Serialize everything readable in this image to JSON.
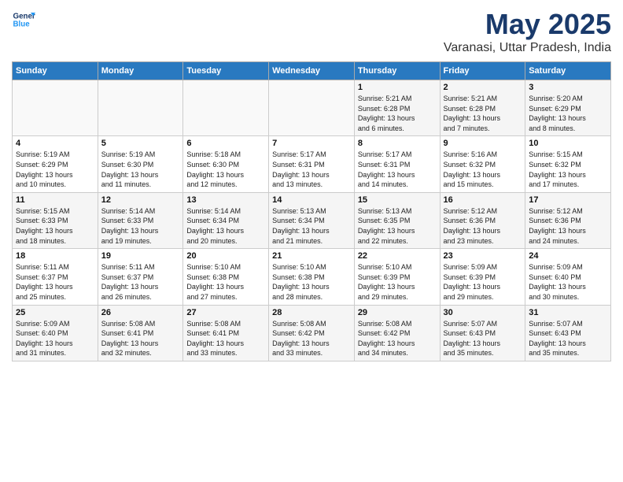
{
  "header": {
    "logo_line1": "General",
    "logo_line2": "Blue",
    "month": "May 2025",
    "location": "Varanasi, Uttar Pradesh, India"
  },
  "days_of_week": [
    "Sunday",
    "Monday",
    "Tuesday",
    "Wednesday",
    "Thursday",
    "Friday",
    "Saturday"
  ],
  "weeks": [
    [
      {
        "day": "",
        "info": ""
      },
      {
        "day": "",
        "info": ""
      },
      {
        "day": "",
        "info": ""
      },
      {
        "day": "",
        "info": ""
      },
      {
        "day": "1",
        "info": "Sunrise: 5:21 AM\nSunset: 6:28 PM\nDaylight: 13 hours\nand 6 minutes."
      },
      {
        "day": "2",
        "info": "Sunrise: 5:21 AM\nSunset: 6:28 PM\nDaylight: 13 hours\nand 7 minutes."
      },
      {
        "day": "3",
        "info": "Sunrise: 5:20 AM\nSunset: 6:29 PM\nDaylight: 13 hours\nand 8 minutes."
      }
    ],
    [
      {
        "day": "4",
        "info": "Sunrise: 5:19 AM\nSunset: 6:29 PM\nDaylight: 13 hours\nand 10 minutes."
      },
      {
        "day": "5",
        "info": "Sunrise: 5:19 AM\nSunset: 6:30 PM\nDaylight: 13 hours\nand 11 minutes."
      },
      {
        "day": "6",
        "info": "Sunrise: 5:18 AM\nSunset: 6:30 PM\nDaylight: 13 hours\nand 12 minutes."
      },
      {
        "day": "7",
        "info": "Sunrise: 5:17 AM\nSunset: 6:31 PM\nDaylight: 13 hours\nand 13 minutes."
      },
      {
        "day": "8",
        "info": "Sunrise: 5:17 AM\nSunset: 6:31 PM\nDaylight: 13 hours\nand 14 minutes."
      },
      {
        "day": "9",
        "info": "Sunrise: 5:16 AM\nSunset: 6:32 PM\nDaylight: 13 hours\nand 15 minutes."
      },
      {
        "day": "10",
        "info": "Sunrise: 5:15 AM\nSunset: 6:32 PM\nDaylight: 13 hours\nand 17 minutes."
      }
    ],
    [
      {
        "day": "11",
        "info": "Sunrise: 5:15 AM\nSunset: 6:33 PM\nDaylight: 13 hours\nand 18 minutes."
      },
      {
        "day": "12",
        "info": "Sunrise: 5:14 AM\nSunset: 6:33 PM\nDaylight: 13 hours\nand 19 minutes."
      },
      {
        "day": "13",
        "info": "Sunrise: 5:14 AM\nSunset: 6:34 PM\nDaylight: 13 hours\nand 20 minutes."
      },
      {
        "day": "14",
        "info": "Sunrise: 5:13 AM\nSunset: 6:34 PM\nDaylight: 13 hours\nand 21 minutes."
      },
      {
        "day": "15",
        "info": "Sunrise: 5:13 AM\nSunset: 6:35 PM\nDaylight: 13 hours\nand 22 minutes."
      },
      {
        "day": "16",
        "info": "Sunrise: 5:12 AM\nSunset: 6:36 PM\nDaylight: 13 hours\nand 23 minutes."
      },
      {
        "day": "17",
        "info": "Sunrise: 5:12 AM\nSunset: 6:36 PM\nDaylight: 13 hours\nand 24 minutes."
      }
    ],
    [
      {
        "day": "18",
        "info": "Sunrise: 5:11 AM\nSunset: 6:37 PM\nDaylight: 13 hours\nand 25 minutes."
      },
      {
        "day": "19",
        "info": "Sunrise: 5:11 AM\nSunset: 6:37 PM\nDaylight: 13 hours\nand 26 minutes."
      },
      {
        "day": "20",
        "info": "Sunrise: 5:10 AM\nSunset: 6:38 PM\nDaylight: 13 hours\nand 27 minutes."
      },
      {
        "day": "21",
        "info": "Sunrise: 5:10 AM\nSunset: 6:38 PM\nDaylight: 13 hours\nand 28 minutes."
      },
      {
        "day": "22",
        "info": "Sunrise: 5:10 AM\nSunset: 6:39 PM\nDaylight: 13 hours\nand 29 minutes."
      },
      {
        "day": "23",
        "info": "Sunrise: 5:09 AM\nSunset: 6:39 PM\nDaylight: 13 hours\nand 29 minutes."
      },
      {
        "day": "24",
        "info": "Sunrise: 5:09 AM\nSunset: 6:40 PM\nDaylight: 13 hours\nand 30 minutes."
      }
    ],
    [
      {
        "day": "25",
        "info": "Sunrise: 5:09 AM\nSunset: 6:40 PM\nDaylight: 13 hours\nand 31 minutes."
      },
      {
        "day": "26",
        "info": "Sunrise: 5:08 AM\nSunset: 6:41 PM\nDaylight: 13 hours\nand 32 minutes."
      },
      {
        "day": "27",
        "info": "Sunrise: 5:08 AM\nSunset: 6:41 PM\nDaylight: 13 hours\nand 33 minutes."
      },
      {
        "day": "28",
        "info": "Sunrise: 5:08 AM\nSunset: 6:42 PM\nDaylight: 13 hours\nand 33 minutes."
      },
      {
        "day": "29",
        "info": "Sunrise: 5:08 AM\nSunset: 6:42 PM\nDaylight: 13 hours\nand 34 minutes."
      },
      {
        "day": "30",
        "info": "Sunrise: 5:07 AM\nSunset: 6:43 PM\nDaylight: 13 hours\nand 35 minutes."
      },
      {
        "day": "31",
        "info": "Sunrise: 5:07 AM\nSunset: 6:43 PM\nDaylight: 13 hours\nand 35 minutes."
      }
    ]
  ]
}
